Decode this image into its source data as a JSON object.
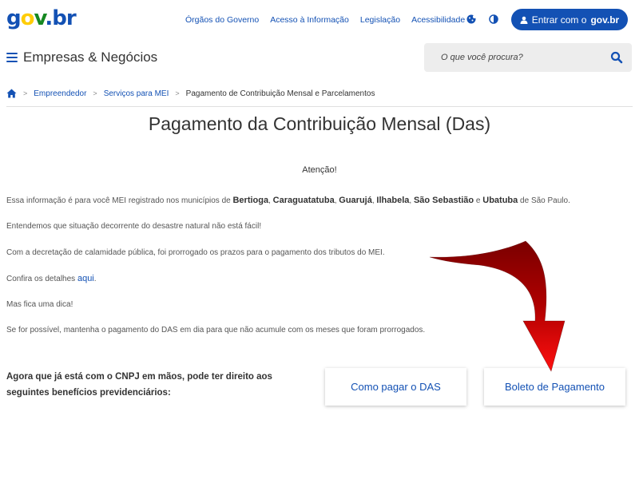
{
  "logo": {
    "g": "g",
    "o": "o",
    "v": "v",
    "dotbr": ".br"
  },
  "top_nav": {
    "links": [
      "Órgãos do Governo",
      "Acesso à Informação",
      "Legislação",
      "Acessibilidade"
    ],
    "icons": [
      "cookie-icon",
      "contrast-icon"
    ],
    "login": {
      "prefix": "Entrar com o",
      "brand": "gov.br",
      "icon": "user-icon"
    }
  },
  "header": {
    "title": "Empresas & Negócios",
    "search_placeholder": "O que você procura?"
  },
  "breadcrumb": {
    "items": [
      "Empreendedor",
      "Serviços para MEI"
    ],
    "current": "Pagamento de Contribuição Mensal e Parcelamentos"
  },
  "page": {
    "title": "Pagamento da Contribuição Mensal (Das)",
    "attention": "Atenção!",
    "p1": {
      "lead": "Essa informação é para você MEI registrado nos municípios de ",
      "cities": [
        "Bertioga",
        "Caraguatatuba",
        "Guarujá",
        "Ilhabela",
        "São Sebastião",
        "Ubatuba"
      ],
      "sep_comma": ", ",
      "sep_and": " e ",
      "trail": " de São Paulo."
    },
    "p2": "Entendemos que situação decorrente do desastre natural não está fácil!",
    "p3": "Com a decretação de calamidade pública, foi prorrogado os prazos para o pagamento dos tributos do MEI.",
    "p4": {
      "text": "Confira os detalhes ",
      "link": "aqui",
      "end": "."
    },
    "p5": "Mas fica uma dica!",
    "p6": "Se for possível, mantenha o pagamento do DAS em dia para que não acumule com os meses que foram prorrogados.",
    "benefits": "Agora que já está com o CNPJ em mãos, pode ter direito aos seguintes benefícios previdenciários:",
    "buttons": [
      "Como pagar o DAS",
      "Boleto de Pagamento"
    ]
  },
  "colors": {
    "primary": "#1351b4",
    "arrow": "#c00000"
  }
}
